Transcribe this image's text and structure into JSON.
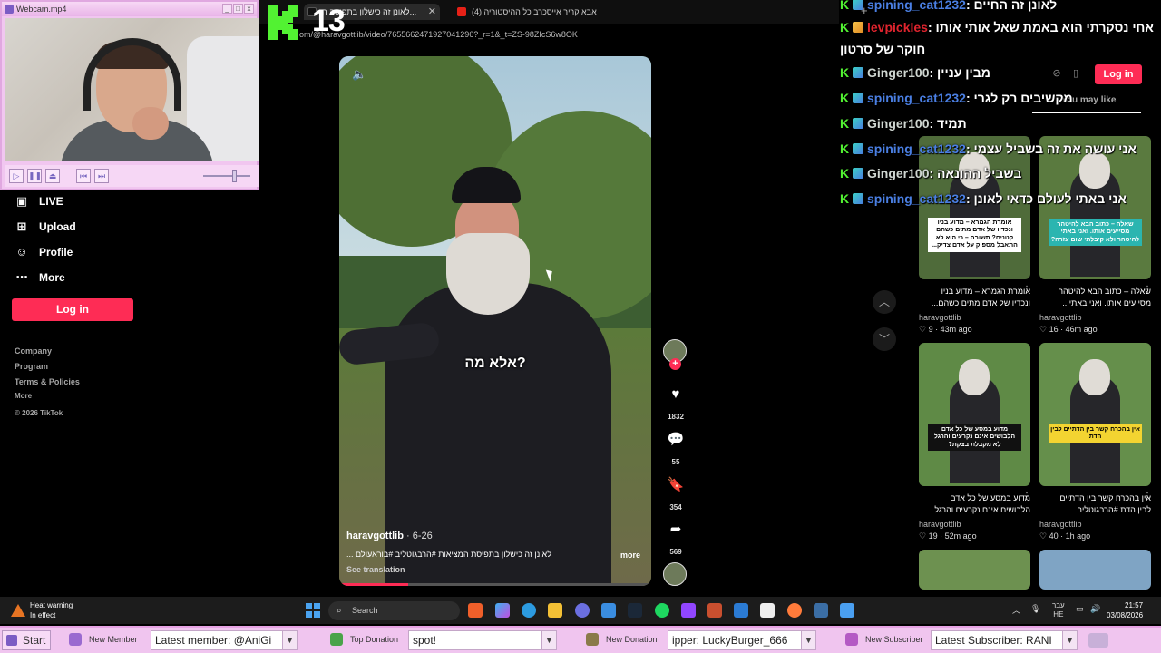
{
  "browser": {
    "tab_active_title": "לאונן זה כישלון בתפיסה ה...",
    "tab_second_title": "(4) אבא קריר אייסכרב כל ההיסטוריה",
    "url": "om/@haravgottlib/video/7655662471927041296?_r=1&_t=ZS-98ZIcS6w8OK",
    "k_number": "13"
  },
  "webcam": {
    "title": "Webcam.mp4",
    "buttons": [
      "_",
      "□",
      "x"
    ]
  },
  "nav": {
    "items": [
      {
        "label": "LIVE",
        "icon": "live-icon"
      },
      {
        "label": "Upload",
        "icon": "upload-icon"
      },
      {
        "label": "Profile",
        "icon": "profile-icon"
      },
      {
        "label": "More",
        "icon": "more-icon"
      }
    ],
    "login_label": "Log in",
    "footer": [
      "Company",
      "Program",
      "Terms & Policies",
      "More",
      "© 2026 TikTok"
    ]
  },
  "video": {
    "caption": "אלא מה?",
    "author": "haravgottlib",
    "date": "· 6-26",
    "description": "לאונן זה כישלון בתפיסת המציאות #הרבגוטליב #בוראעולם ...",
    "more_label": "more",
    "translate_label": "See translation",
    "progress": 0.22
  },
  "actions": {
    "likes": "1832",
    "comments": "55",
    "saves": "354",
    "shares": "569"
  },
  "chat": [
    {
      "name": "spining_cat1232",
      "msg": ": לאונן זה החיים",
      "color": "blue"
    },
    {
      "name": "levpickles",
      "msg": ": אחי נסקרתי הוא באמת שאל אותי אותו",
      "color": "red"
    },
    {
      "name": "",
      "msg": "חוקר של סרטון",
      "color": "none"
    },
    {
      "name": "Ginger100",
      "msg": ": מבין עניין",
      "color": "green"
    },
    {
      "name": "spining_cat1232",
      "msg": ": מקשיבים רק לגרי",
      "color": "blue"
    },
    {
      "name": "Ginger100",
      "msg": ": תמיד",
      "color": "green"
    },
    {
      "name": "spining_cat1232",
      "msg": ": אני עושה את זה בשביל עצמי",
      "color": "blue"
    },
    {
      "name": "Ginger100",
      "msg": ": בשביל ההונאה",
      "color": "green"
    },
    {
      "name": "spining_cat1232",
      "msg": ": אני באתי לעולם כדאי לאונן",
      "color": "blue"
    }
  ],
  "right_panel": {
    "login_label": "Log in",
    "you_may_like": "You may like"
  },
  "thumbnails": [
    {
      "label": "אומרת הגמרא – מדוע בניו ונכדיו של אדם מתים כשהם קטנים? תשובה – כי הוא לא התאבל מספיק על אדם צדיק...",
      "caption1": "אומרת הגמרא – מדוע בניו",
      "caption2": "ונכדיו של אדם מתים כשהם...",
      "author": "haravgottlib",
      "stat": "9 · 43m ago",
      "style": "white"
    },
    {
      "label": "שאלה – כתוב הבא להיטהר מסייעים אותו. ואני באתי להיטהר ולא קיבלתי שום עזרה?",
      "caption1": "שאלה – כתוב הבא להיטהר",
      "caption2": "מסייעים אותו. ואני באתי...",
      "author": "haravgottlib",
      "stat": "16 · 46m ago",
      "style": "teal"
    },
    {
      "label": "מדוע במסע של כל אדם הלבושים אינם נקרעים והרגל לא מקבלת בצקת?",
      "caption1": "מדוע במסע של כל אדם",
      "caption2": "הלבושים אינם נקרעים והרגל...",
      "author": "haravgottlib",
      "stat": "19 · 52m ago",
      "style": "black"
    },
    {
      "label": "אין בהכרח קשר בין הדתיים לבין הדת",
      "caption1": "אין בהכרח קשר בין הדתיים",
      "caption2": "לבין הדת #הרבגוטליב...",
      "author": "haravgottlib",
      "stat": "40 · 1h ago",
      "style": "yellow"
    }
  ],
  "taskbar": {
    "heat_title": "Heat warning",
    "heat_sub": "In effect",
    "search_label": "Search",
    "lang_top": "עבר",
    "lang_bottom": "HE",
    "time": "21:57",
    "date": "03/08/2026"
  },
  "bottom_bar": {
    "start_label": "Start",
    "new_member_label": "New Member",
    "new_member_value": "Latest member: @AniGi",
    "top_donation_label": "Top Donation",
    "top_donation_value": "spot!",
    "new_donation_label": "New Donation",
    "new_donation_value": "ipper: LuckyBurger_666",
    "new_subscriber_label": "New Subscriber",
    "new_subscriber_value": "Latest Subscriber: RANI"
  },
  "colors": {
    "tiktok_red": "#fe2c55",
    "chat_blue": "#4a7fe3",
    "overlay_pink": "#f0c5ef",
    "k_green": "#52f232"
  }
}
